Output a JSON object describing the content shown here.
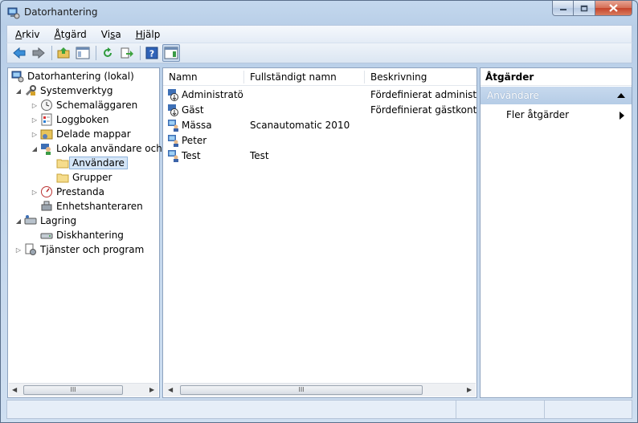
{
  "window": {
    "title": "Datorhantering",
    "icon": "computer-management-icon",
    "controls": {
      "minimize": "minimize-icon",
      "maximize": "maximize-icon",
      "close": "close-icon"
    }
  },
  "menu": [
    {
      "label": "Arkiv",
      "mnemonic": "A",
      "rest": "rkiv"
    },
    {
      "label": "Åtgärd",
      "mnemonic": "Å",
      "rest": "tgärd"
    },
    {
      "label": "Visa",
      "pre": "Vi",
      "mnemonic": "s",
      "rest": "a"
    },
    {
      "label": "Hjälp",
      "mnemonic": "H",
      "rest": "jälp"
    }
  ],
  "toolbar": [
    "back-arrow-icon",
    "forward-arrow-icon",
    "up-folder-icon",
    "show-hide-console-tree-icon",
    "refresh-icon",
    "export-list-icon",
    "help-icon",
    "show-hide-action-pane-icon"
  ],
  "tree": {
    "root": "Datorhantering (lokal)",
    "system_tools": "Systemverktyg",
    "scheduler": "Schemaläggaren",
    "event_viewer": "Loggboken",
    "shared_folders": "Delade mappar",
    "local_users": "Lokala användare och g",
    "users": "Användare",
    "groups": "Grupper",
    "performance": "Prestanda",
    "device_manager": "Enhetshanteraren",
    "storage": "Lagring",
    "disk_management": "Diskhantering",
    "services": "Tjänster och program"
  },
  "list": {
    "columns": {
      "name": "Namn",
      "full_name": "Fullständigt namn",
      "description": "Beskrivning"
    },
    "rows": [
      {
        "name": "Administratör",
        "full_name": "",
        "description": "Fördefinierat administrat",
        "icon": "disabled-user-icon"
      },
      {
        "name": "Gäst",
        "full_name": "",
        "description": "Fördefinierat gästkonto fö",
        "icon": "disabled-user-icon"
      },
      {
        "name": "Mässa",
        "full_name": "Scanautomatic 2010",
        "description": "",
        "icon": "user-icon"
      },
      {
        "name": "Peter",
        "full_name": "",
        "description": "",
        "icon": "user-icon"
      },
      {
        "name": "Test",
        "full_name": "Test",
        "description": "",
        "icon": "user-icon"
      }
    ]
  },
  "actions": {
    "title": "Åtgärder",
    "section": "Användare",
    "more": "Fler åtgärder"
  },
  "scroll_thumb_glyph": "III",
  "colors": {
    "selection_bg": "#d4e5f7",
    "action_header": "#b5cce6"
  }
}
